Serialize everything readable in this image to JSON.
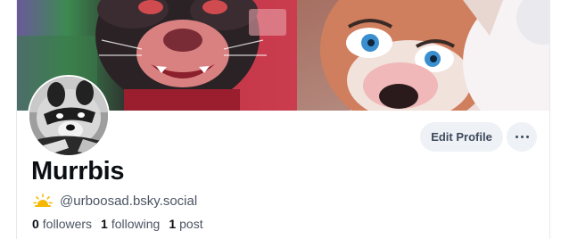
{
  "profile": {
    "display_name": "Murrbis",
    "handle_emoji_icon": "sun-behind-cloud-icon",
    "handle": "@urboosad.bsky.social"
  },
  "actions": {
    "edit_profile_label": "Edit Profile",
    "more_icon": "ellipsis-icon"
  },
  "stats": {
    "followers_count": "0",
    "followers_label": "followers",
    "following_count": "1",
    "following_label": "following",
    "posts_count": "1",
    "posts_label": "post"
  },
  "colors": {
    "button_background": "#eef1f5",
    "text_primary": "#0b0f14",
    "text_secondary": "#4b5563",
    "sun_icon": "#f5b800"
  }
}
